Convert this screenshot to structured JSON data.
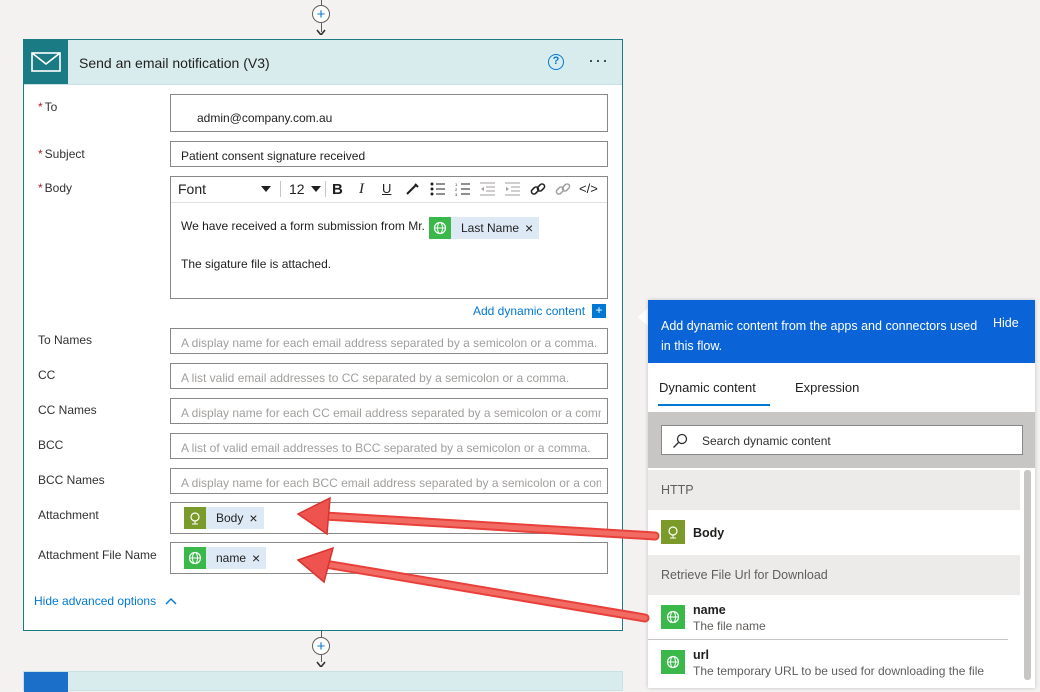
{
  "card": {
    "title": "Send an email notification (V3)",
    "help_glyph": "?",
    "more_glyph": "···"
  },
  "fields": {
    "to": {
      "label": "To",
      "value": "admin@company.com.au"
    },
    "subject": {
      "label": "Subject",
      "value": "Patient consent signature received"
    },
    "body": {
      "label": "Body",
      "toolbar": {
        "font": "Font",
        "size": "12",
        "bold": "B",
        "italic": "I",
        "underline": "U",
        "code": "</>"
      },
      "line1": "We have received a form submission from Mr.",
      "token": "Last Name",
      "line2": "The sigature file is attached."
    },
    "add_dynamic": "Add dynamic content",
    "to_names": {
      "label": "To Names",
      "placeholder": "A display name for each email address separated by a semicolon or a comma."
    },
    "cc": {
      "label": "CC",
      "placeholder": "A list valid email addresses to CC separated by a semicolon or a comma."
    },
    "cc_names": {
      "label": "CC Names",
      "placeholder": "A display name for each CC email address separated by a semicolon or a comma."
    },
    "bcc": {
      "label": "BCC",
      "placeholder": "A list of valid email addresses to BCC separated by a semicolon or a comma."
    },
    "bcc_names": {
      "label": "BCC Names",
      "placeholder": "A display name for each BCC email address separated by a semicolon or a comma."
    },
    "attachment": {
      "label": "Attachment",
      "token": "Body"
    },
    "attachment_name": {
      "label": "Attachment File Name",
      "token": "name"
    },
    "hide_advanced": "Hide advanced options",
    "required_mark": "*"
  },
  "panel": {
    "header": "Add dynamic content from the apps and connectors used in this flow.",
    "hide": "Hide",
    "tabs": [
      "Dynamic content",
      "Expression"
    ],
    "search_placeholder": "Search dynamic content",
    "sections": [
      {
        "title": "HTTP",
        "items": [
          {
            "name": "Body",
            "desc": ""
          }
        ]
      },
      {
        "title": "Retrieve File Url for Download",
        "items": [
          {
            "name": "name",
            "desc": "The file name"
          },
          {
            "name": "url",
            "desc": "The temporary URL to be used for downloading the file"
          }
        ]
      }
    ]
  },
  "colors": {
    "accent": "#0078d4",
    "teal": "#1b7b85",
    "http_green": "#7a9a2a",
    "sharepoint_green": "#3bb84a",
    "arrow_red": "#ef5350",
    "panel_blue": "#0a64d8"
  },
  "icons": {
    "mail": "mail-icon",
    "http": "globe-icon",
    "file": "globe-icon",
    "search": "search-icon",
    "close": "close-icon",
    "add": "plus-icon"
  },
  "plus_glyph": "+",
  "close_glyph": "×"
}
